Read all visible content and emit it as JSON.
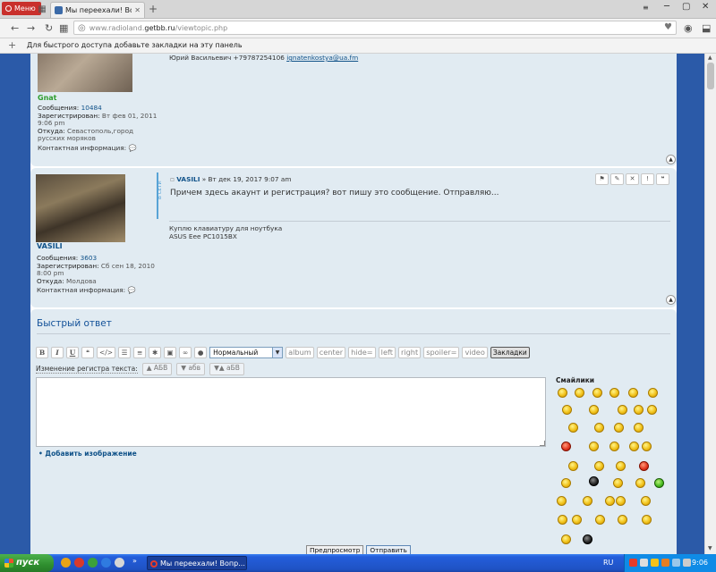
{
  "browser": {
    "menu_label": "Меню",
    "tab_title": "Мы переехали! Вопросы и",
    "url_prefix": "www.radioland.",
    "url_domain": "getbb.ru",
    "url_path": "/viewtopic.php",
    "bookmarks_hint": "Для быстрого доступа добавьте закладки на эту панель"
  },
  "post1": {
    "username": "Gnat",
    "stats": [
      {
        "k": "Сообщения:",
        "v": "10484"
      },
      {
        "k": "Зарегистрирован:",
        "v": "Вт фев 01, 2011 9:06 pm"
      },
      {
        "k": "Откуда:",
        "v": "Севастополь,город русских моряков"
      }
    ],
    "contact_label": "Контактная информация:",
    "signature_line": "Юрий Васильевич +79787254106",
    "signature_email": "ignatenkostya@ua.fm"
  },
  "post2": {
    "online_label": "В СЕТИ",
    "author": "VASILI",
    "date": "» Вт дек 19, 2017 9:07 am",
    "body": "Причем здесь акаунт и регистрация? вот пишу это сообщение. Отправляю...",
    "signature": [
      "Куплю клавиатуру для ноутбука",
      "ASUS Eee PC1015BX"
    ],
    "username": "VASILI",
    "stats": [
      {
        "k": "Сообщения:",
        "v": "3603"
      },
      {
        "k": "Зарегистрирован:",
        "v": "Сб сен 18, 2010 8:00 pm"
      },
      {
        "k": "Откуда:",
        "v": "Молдова"
      }
    ],
    "contact_label": "Контактная информация:"
  },
  "quick_reply": {
    "title": "Быстрый ответ",
    "font_size_select": "Нормальный",
    "bbcodes": [
      "album",
      "center",
      "hide=",
      "left",
      "right",
      "spoiler=",
      "video"
    ],
    "bookmarks_button": "Закладки",
    "case_label": "Изменение регистра текста:",
    "case_buttons": [
      "▲ АБВ",
      "▼ абв",
      "▼▲ аБВ"
    ],
    "add_image": "Добавить изображение",
    "smilies_title": "Смайлики",
    "preview_button": "Предпросмотр",
    "submit_button": "Отправить"
  },
  "taskbar": {
    "start_label": "пуск",
    "task_title": "Мы переехали! Вопр...",
    "language": "RU",
    "clock": "9:06"
  }
}
